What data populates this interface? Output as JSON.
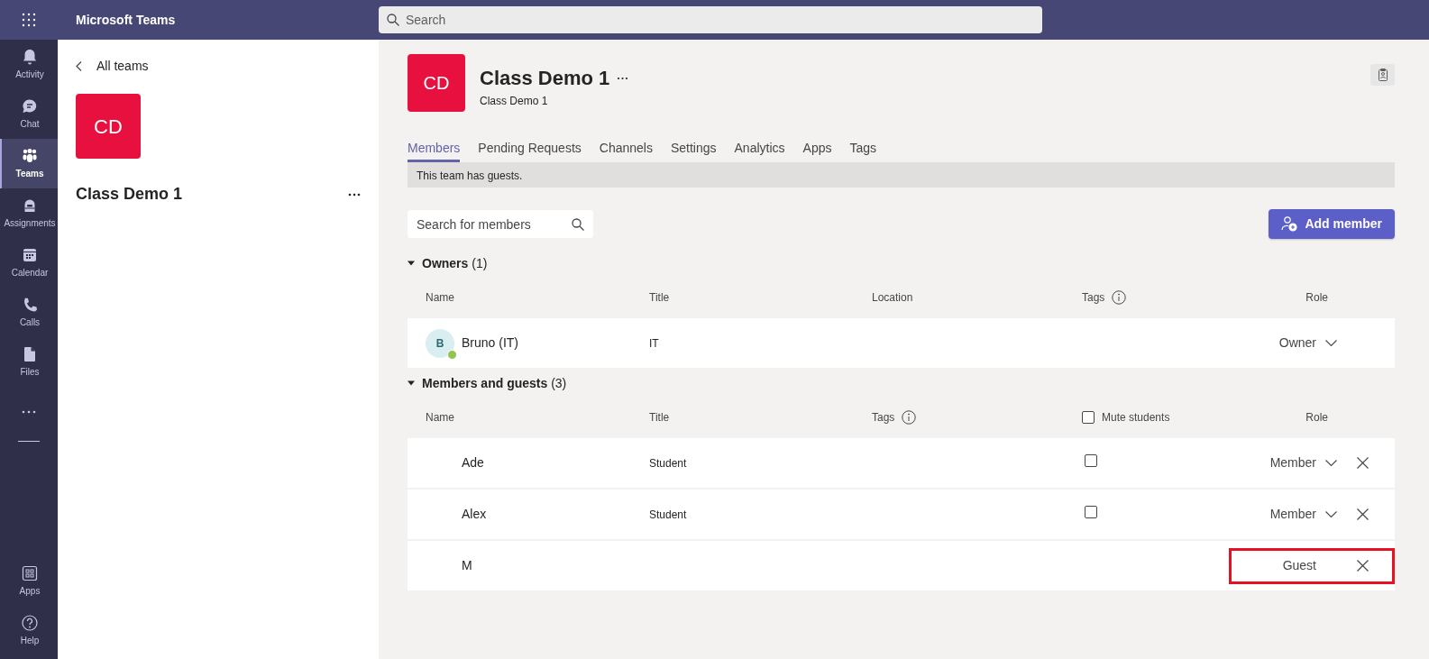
{
  "app": {
    "title": "Microsoft Teams",
    "search_placeholder": "Search"
  },
  "rail": {
    "items": [
      {
        "kind": "bell",
        "label": "Activity",
        "selected": false
      },
      {
        "kind": "chat",
        "label": "Chat",
        "selected": false
      },
      {
        "kind": "teams",
        "label": "Teams",
        "selected": true
      },
      {
        "kind": "backpack",
        "label": "Assignments",
        "selected": false
      },
      {
        "kind": "calendar",
        "label": "Calendar",
        "selected": false
      },
      {
        "kind": "phone",
        "label": "Calls",
        "selected": false
      },
      {
        "kind": "file",
        "label": "Files",
        "selected": false
      }
    ],
    "bottom": [
      {
        "kind": "apps",
        "label": "Apps",
        "selected": false
      },
      {
        "kind": "help",
        "label": "Help",
        "selected": false
      }
    ]
  },
  "left_panel": {
    "back": "All teams",
    "avatar": "CD",
    "team_name": "Class Demo 1"
  },
  "header": {
    "avatar": "CD",
    "title": "Class Demo 1",
    "subtitle": "Class Demo 1"
  },
  "tabs": [
    {
      "label": "Members",
      "selected": true
    },
    {
      "label": "Pending Requests",
      "selected": false
    },
    {
      "label": "Channels",
      "selected": false
    },
    {
      "label": "Settings",
      "selected": false
    },
    {
      "label": "Analytics",
      "selected": false
    },
    {
      "label": "Apps",
      "selected": false
    },
    {
      "label": "Tags",
      "selected": false
    }
  ],
  "banner": "This team has guests.",
  "member_search": {
    "placeholder": "Search for members"
  },
  "add_button": "Add member",
  "sections": [
    {
      "title": "Owners",
      "count": "(1)",
      "expanded": true,
      "columns": [
        {
          "kind": "text",
          "label": "Name"
        },
        {
          "kind": "text",
          "label": "Title"
        },
        {
          "kind": "text",
          "label": "Location"
        },
        {
          "kind": "info",
          "label": "Tags"
        },
        {
          "kind": "text",
          "label": "Role"
        }
      ],
      "rows": [
        {
          "avatar": "B",
          "online": true,
          "name": "Bruno (IT)",
          "title": "IT",
          "role": "Owner",
          "role_dropdown": true,
          "removable": false,
          "highlighted": false
        }
      ]
    },
    {
      "title": "Members and guests",
      "count": "(3)",
      "expanded": true,
      "columns": [
        {
          "kind": "text",
          "label": "Name"
        },
        {
          "kind": "text",
          "label": "Title"
        },
        {
          "kind": "info",
          "label": "Tags"
        },
        {
          "kind": "checkbox",
          "label": "Mute students",
          "checked": false
        },
        {
          "kind": "text",
          "label": "Role"
        }
      ],
      "rows": [
        {
          "name": "Ade",
          "title": "Student",
          "muted": false,
          "role": "Member",
          "role_dropdown": true,
          "removable": true,
          "highlighted": false
        },
        {
          "name": "Alex",
          "title": "Student",
          "muted": false,
          "role": "Member",
          "role_dropdown": true,
          "removable": true,
          "highlighted": false
        },
        {
          "name": "M",
          "role": "Guest",
          "role_dropdown": false,
          "removable": true,
          "highlighted": true
        }
      ]
    }
  ]
}
